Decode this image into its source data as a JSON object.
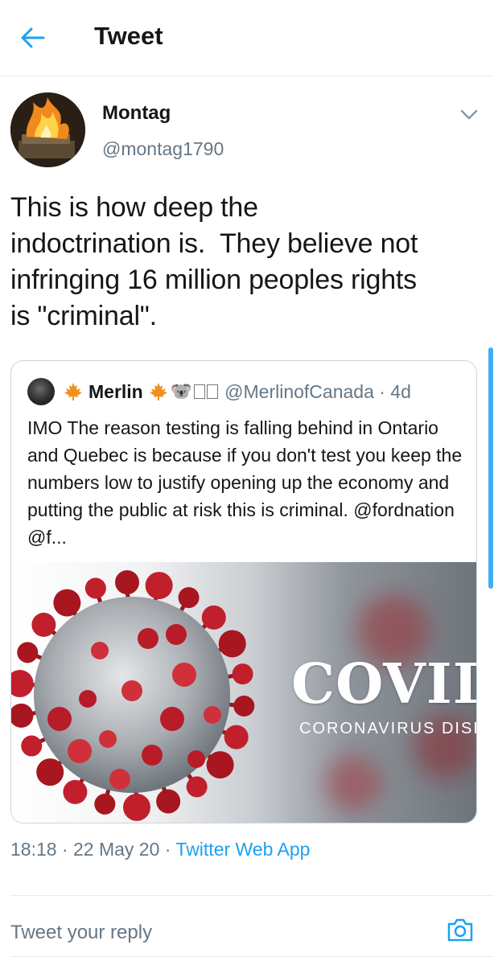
{
  "header": {
    "title": "Tweet",
    "back_icon": "arrow-left-icon"
  },
  "tweet": {
    "author_name": "Montag",
    "author_handle": "@montag1790",
    "text": "This is how deep the\nindoctrination is.  They believe not\ninfringing 16 million peoples rights\nis \"criminal\".",
    "timestamp": "18:18 · 22 May 20 · ",
    "source": "Twitter Web App"
  },
  "quote": {
    "name": "Merlin",
    "emoji": "🐨",
    "handle": "@MerlinofCanada · 4d",
    "text": "IMO The reason testing is falling behind in Ontario and Quebec is because if you don't test you keep the numbers low to justify opening up the economy and putting the public at risk this is criminal. @fordnation @f...",
    "image_title": "COVID",
    "image_subtitle": "CORONAVIRUS DISEA"
  },
  "reply": {
    "placeholder": "Tweet your reply"
  },
  "colors": {
    "accent": "#1da1f2",
    "secondary_text": "#657786",
    "primary_text": "#14171a",
    "border": "#e6ecf0",
    "maple_leaf": "#f0901e",
    "virus_spike": "#c21f2c"
  }
}
